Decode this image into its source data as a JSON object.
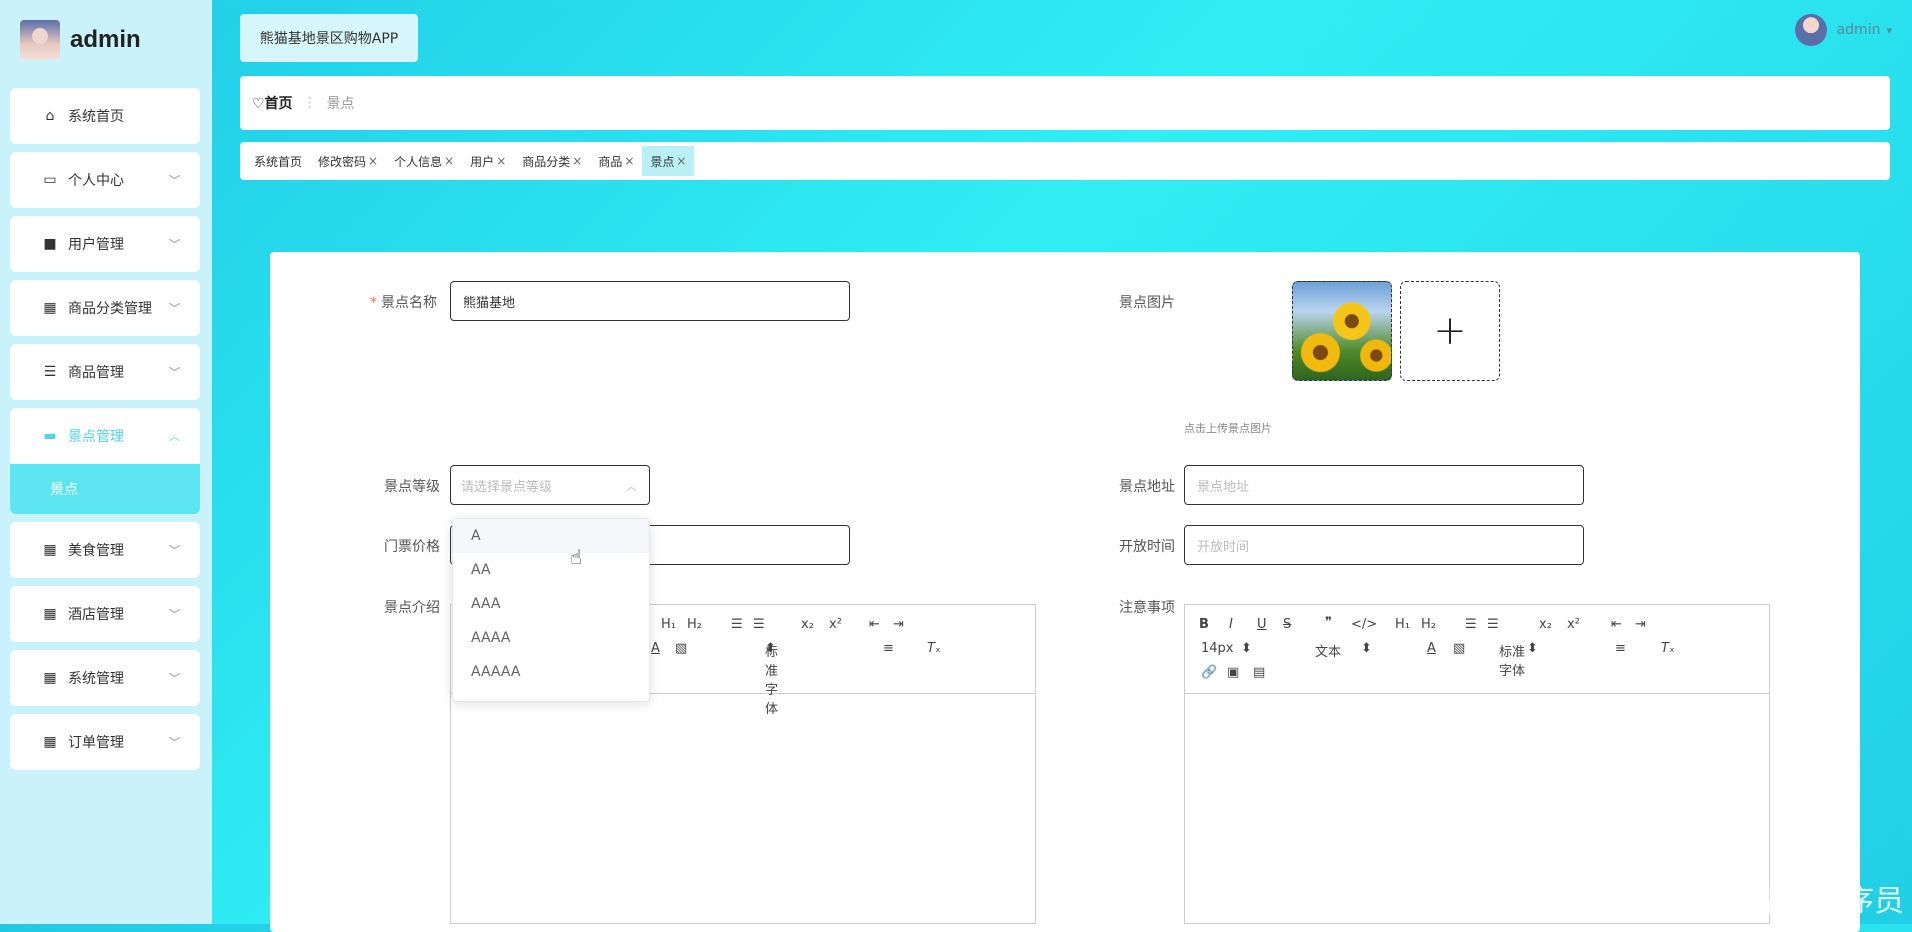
{
  "sidebar": {
    "brand": "admin",
    "items": [
      {
        "label": "系统首页",
        "icon": "home-icon",
        "glyph": "⌂"
      },
      {
        "label": "个人中心",
        "icon": "card-icon",
        "glyph": "▭"
      },
      {
        "label": "用户管理",
        "icon": "briefcase-icon",
        "glyph": "■"
      },
      {
        "label": "商品分类管理",
        "icon": "grid-icon",
        "glyph": "▦"
      },
      {
        "label": "商品管理",
        "icon": "sliders-icon",
        "glyph": "☰"
      },
      {
        "label": "景点管理",
        "icon": "monitor-icon",
        "glyph": "▬"
      },
      {
        "label": "美食管理",
        "icon": "grid-icon",
        "glyph": "▦"
      },
      {
        "label": "酒店管理",
        "icon": "grid-icon",
        "glyph": "▦"
      },
      {
        "label": "系统管理",
        "icon": "grid-icon",
        "glyph": "▦"
      },
      {
        "label": "订单管理",
        "icon": "grid-icon",
        "glyph": "▦"
      }
    ],
    "submenu_item": "景点"
  },
  "header": {
    "app_title": "熊猫基地景区购物APP",
    "user": "admin"
  },
  "breadcrumb": {
    "home": "♡首页",
    "separator": "⋮",
    "current": "景点"
  },
  "tabs": [
    {
      "label": "系统首页",
      "closable": false
    },
    {
      "label": "修改密码",
      "closable": true
    },
    {
      "label": "个人信息",
      "closable": true
    },
    {
      "label": "用户",
      "closable": true
    },
    {
      "label": "商品分类",
      "closable": true
    },
    {
      "label": "商品",
      "closable": true
    },
    {
      "label": "景点",
      "closable": true,
      "active": true
    }
  ],
  "form": {
    "name_label": "景点名称",
    "name_value": "熊猫基地",
    "image_label": "景点图片",
    "upload_hint": "点击上传景点图片",
    "level_label": "景点等级",
    "level_placeholder": "请选择景点等级",
    "level_options": [
      "A",
      "AA",
      "AAA",
      "AAAA",
      "AAAAA"
    ],
    "address_label": "景点地址",
    "address_placeholder": "景点地址",
    "price_label": "门票价格",
    "open_label": "开放时间",
    "open_placeholder": "开放时间",
    "intro_label": "景点介绍",
    "notes_label": "注意事项"
  },
  "editor": {
    "size": "14px",
    "text": "文本",
    "font": "标准字体"
  },
  "watermark": "CSDN @毕业程序员"
}
